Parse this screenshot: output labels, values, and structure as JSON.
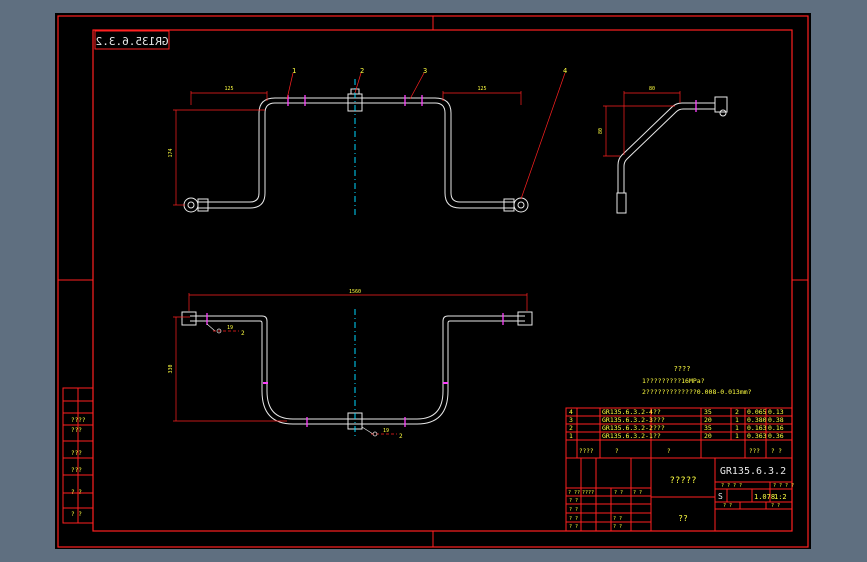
{
  "drawing": {
    "mirrored_code": "GR135.6.3.2",
    "balloons": [
      "1",
      "2",
      "3",
      "4"
    ],
    "dims": {
      "top_left": "125",
      "top_right": "125",
      "top_height": "174",
      "side_width": "80",
      "side_height": "80",
      "plan_width": "1560",
      "plan_height": "330",
      "callout": "19"
    },
    "callout_mark": "2",
    "notes": {
      "title": "????",
      "line1": "1?????????16MPa?",
      "line2": "2?????????????0.008-0.013mm?"
    },
    "left_strip": [
      "????",
      "???",
      "???",
      "???",
      "? ?",
      "? ?"
    ]
  },
  "parts_list": [
    {
      "no": "4",
      "code": "GR135.6.3.2-4",
      "name": "??",
      "material": "35",
      "qty": "2",
      "weight": "0.065",
      "total": "0.13"
    },
    {
      "no": "3",
      "code": "GR135.6.3.2-3",
      "name": "???",
      "material": "20",
      "qty": "1",
      "weight": "0.380",
      "total": "0.38"
    },
    {
      "no": "2",
      "code": "GR135.6.3.2-2",
      "name": "???",
      "material": "35",
      "qty": "1",
      "weight": "0.163",
      "total": "0.16"
    },
    {
      "no": "1",
      "code": "GR135.6.3.2-1",
      "name": "??",
      "material": "20",
      "qty": "1",
      "weight": "0.363",
      "total": "0.36"
    }
  ],
  "parts_header": [
    "????",
    "?",
    "?",
    "???",
    "? ?"
  ],
  "title_block": {
    "drawing_code": "GR135.6.3.2",
    "name": "?????",
    "company": "??",
    "stage_labels": "? ? ? ?",
    "sheet_labels": "? ? ? ?",
    "stage_mark": "S",
    "weight": "1.078",
    "scale": "1:2",
    "sheet": "? ?",
    "sheets": "? ?",
    "sign_row": [
      "? ??",
      "????",
      "? ?",
      "? ?"
    ],
    "role_labels": [
      "? ?",
      "? ?",
      "? ?",
      "? ?",
      "? ?"
    ],
    "date_labels": [
      "? ?",
      "? ?"
    ]
  }
}
